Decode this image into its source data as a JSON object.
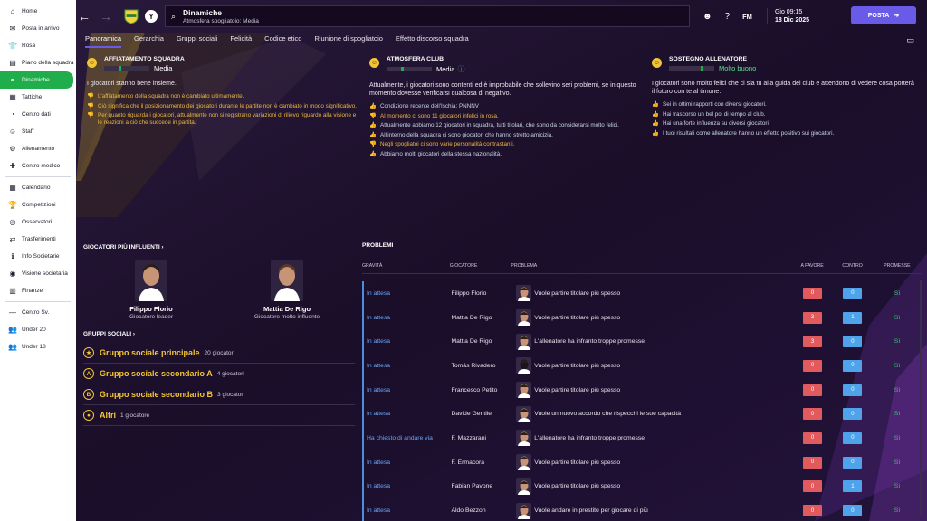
{
  "sidebar": {
    "items": [
      {
        "label": "Home",
        "icon": "home-icon",
        "glyph": "⌂"
      },
      {
        "label": "Posta in arrivo",
        "icon": "inbox-icon",
        "glyph": "✉"
      },
      {
        "label": "Rosa",
        "icon": "shirt-icon",
        "glyph": "👕"
      },
      {
        "label": "Piano della squadra",
        "icon": "plan-icon",
        "glyph": "▤"
      },
      {
        "label": "Dinamiche",
        "icon": "dynamics-icon",
        "glyph": "⚭",
        "active": true
      },
      {
        "label": "Tattiche",
        "icon": "tactics-icon",
        "glyph": "▦"
      },
      {
        "label": "Centro dati",
        "icon": "data-icon",
        "glyph": "◔"
      },
      {
        "label": "Staff",
        "icon": "staff-icon",
        "glyph": "☺"
      },
      {
        "label": "Allenamento",
        "icon": "training-icon",
        "glyph": "⚙"
      },
      {
        "label": "Centro medico",
        "icon": "medical-icon",
        "glyph": "✚"
      },
      {
        "label": "Calendario",
        "icon": "calendar-icon",
        "glyph": "▦"
      },
      {
        "label": "Competizioni",
        "icon": "trophy-icon",
        "glyph": "🏆"
      },
      {
        "label": "Osservatori",
        "icon": "scouting-icon",
        "glyph": "◎"
      },
      {
        "label": "Trasferimenti",
        "icon": "transfer-icon",
        "glyph": "⇄"
      },
      {
        "label": "Info Societarie",
        "icon": "club-info-icon",
        "glyph": "ℹ"
      },
      {
        "label": "Visione societaria",
        "icon": "vision-icon",
        "glyph": "◉"
      },
      {
        "label": "Finanze",
        "icon": "finance-icon",
        "glyph": "▥"
      },
      {
        "label": "Centro Sv.",
        "icon": "development-icon",
        "glyph": "—"
      },
      {
        "label": "Under 20",
        "icon": "u20-icon",
        "glyph": "👥"
      },
      {
        "label": "Under 18",
        "icon": "u18-icon",
        "glyph": "👥"
      }
    ]
  },
  "topbar": {
    "title": "Dinamiche",
    "subtitle": "Atmosfera spogliatoio: Media",
    "badge_letter": "Y",
    "time": "Gio 09:15",
    "date": "18 Dic 2025",
    "fm_label": "FM",
    "posta_label": "POSTA"
  },
  "tabs": [
    "Panoramica",
    "Gerarchia",
    "Gruppi sociali",
    "Felicità",
    "Codice etico",
    "Riunione di spogliatoio",
    "Effetto discorso squadra"
  ],
  "cards": [
    {
      "title": "AFFIATAMENTO SQUADRA",
      "meter_label": "Media",
      "meter_level": 0.35,
      "desc": "I giocatori stanno bene insieme.",
      "factors": [
        {
          "type": "neg",
          "text": "L'affiatamento della squadra non è cambiato ultimamente."
        },
        {
          "type": "neg",
          "text": "Ciò significa che il posizionamento dei giocatori durante le partite non è cambiato in modo significativo."
        },
        {
          "type": "neg",
          "text": "Per quanto riguarda i giocatori, attualmente non si registrano variazioni di rilievo riguardo alla visione e le reazioni a ciò che succede in partita."
        }
      ]
    },
    {
      "title": "ATMOSFERA CLUB",
      "meter_label": "Media",
      "meter_level": 0.35,
      "desc": "Attualmente, i giocatori sono contenti ed è improbabile che sollevino seri problemi, se in questo momento dovesse verificarsi qualcosa di negativo.",
      "factors": [
        {
          "type": "pos",
          "text": "Condizione recente dell'Ischia: PNNNV"
        },
        {
          "type": "neg",
          "text": "Al momento ci sono 11 giocatori infelici in rosa."
        },
        {
          "type": "pos",
          "text": "Attualmente abbiamo 12 giocatori in squadra, tutti titolari, che sono da considerarsi molto felici."
        },
        {
          "type": "pos",
          "text": "All'interno della squadra ci sono giocatori che hanno stretto amicizia."
        },
        {
          "type": "neg",
          "text": "Negli spogliatoi ci sono varie personalità contrastanti."
        },
        {
          "type": "pos",
          "text": "Abbiamo molti giocatori della stessa nazionalità."
        }
      ]
    },
    {
      "title": "SOSTEGNO ALLENATORE",
      "meter_label": "Molto buono",
      "meter_level": 0.75,
      "desc": "I giocatori sono molto felici che ci sia tu alla guida del club e attendono di vedere cosa porterà il futuro con te al timone.",
      "factors": [
        {
          "type": "pos",
          "text": "Sei in ottimi rapporti con diversi giocatori."
        },
        {
          "type": "pos",
          "text": "Hai trascorso un bel po' di tempo al club."
        },
        {
          "type": "pos",
          "text": "Hai una forte influenza su diversi giocatori."
        },
        {
          "type": "pos",
          "text": "I tuoi risultati come allenatore hanno un effetto positivo sui giocatori."
        }
      ]
    }
  ],
  "influential": {
    "title": "GIOCATORI PIÙ INFLUENTI",
    "players": [
      {
        "name": "Filippo Florio",
        "role": "Giocatore leader"
      },
      {
        "name": "Mattia De Rigo",
        "role": "Giocatore molto influente"
      }
    ]
  },
  "groups": {
    "title": "GRUPPI SOCIALI",
    "items": [
      {
        "icon": "★",
        "name": "Gruppo sociale principale",
        "count": "20 giocatori"
      },
      {
        "icon": "A",
        "name": "Gruppo sociale secondario A",
        "count": "4 giocatori"
      },
      {
        "icon": "B",
        "name": "Gruppo sociale secondario B",
        "count": "3 giocatori"
      },
      {
        "icon": "●",
        "name": "Altri",
        "count": "1 giocatore"
      }
    ]
  },
  "problems": {
    "title": "PROBLEMI",
    "headers": {
      "gravita": "GRAVITÀ",
      "giocatore": "GIOCATORE",
      "problema": "PROBLEMA",
      "favore": "A FAVORE",
      "contro": "CONTRO",
      "promesse": "PROMESSE"
    },
    "rows": [
      {
        "gravita": "In attesa",
        "player": "Filippo Florio",
        "problem": "Vuole partire titolare più spesso",
        "favore": "0",
        "contro": "0",
        "promesse": "Sì"
      },
      {
        "gravita": "In attesa",
        "player": "Mattia De Rigo",
        "problem": "Vuole partire titolare più spesso",
        "favore": "3",
        "contro": "1",
        "promesse": "Sì"
      },
      {
        "gravita": "In attesa",
        "player": "Mattia De Rigo",
        "problem": "L'allenatore ha infranto troppe promesse",
        "favore": "3",
        "contro": "0",
        "promesse": "Sì"
      },
      {
        "gravita": "In attesa",
        "player": "Tomás Rivadero",
        "problem": "Vuole partire titolare più spesso",
        "favore": "0",
        "contro": "0",
        "promesse": "Sì"
      },
      {
        "gravita": "In attesa",
        "player": "Francesco Petito",
        "problem": "Vuole partire titolare più spesso",
        "favore": "0",
        "contro": "0",
        "promesse": "Sì"
      },
      {
        "gravita": "In attesa",
        "player": "Davide Gentile",
        "problem": "Vuole un nuovo accordo che rispecchi le sue capacità",
        "favore": "0",
        "contro": "0",
        "promesse": "Sì"
      },
      {
        "gravita": "Ha chiesto di andare via",
        "player": "F. Mazzarani",
        "problem": "L'allenatore ha infranto troppe promesse",
        "favore": "0",
        "contro": "0",
        "promesse": "Sì"
      },
      {
        "gravita": "In attesa",
        "player": "F. Ermacora",
        "problem": "Vuole partire titolare più spesso",
        "favore": "0",
        "contro": "0",
        "promesse": "Sì"
      },
      {
        "gravita": "In attesa",
        "player": "Fabian Pavone",
        "problem": "Vuole partire titolare più spesso",
        "favore": "0",
        "contro": "1",
        "promesse": "Sì"
      },
      {
        "gravita": "In attesa",
        "player": "Aldo Bezzon",
        "problem": "Vuole andare in prestito per giocare di più",
        "favore": "0",
        "contro": "0",
        "promesse": "Sì"
      }
    ]
  },
  "colors": {
    "accent": "#6a5ae8",
    "active_nav": "#1fae4b",
    "gold": "#f2c533",
    "link": "#67a4ef",
    "red": "#e15a5d",
    "blue": "#4ea3ea"
  }
}
